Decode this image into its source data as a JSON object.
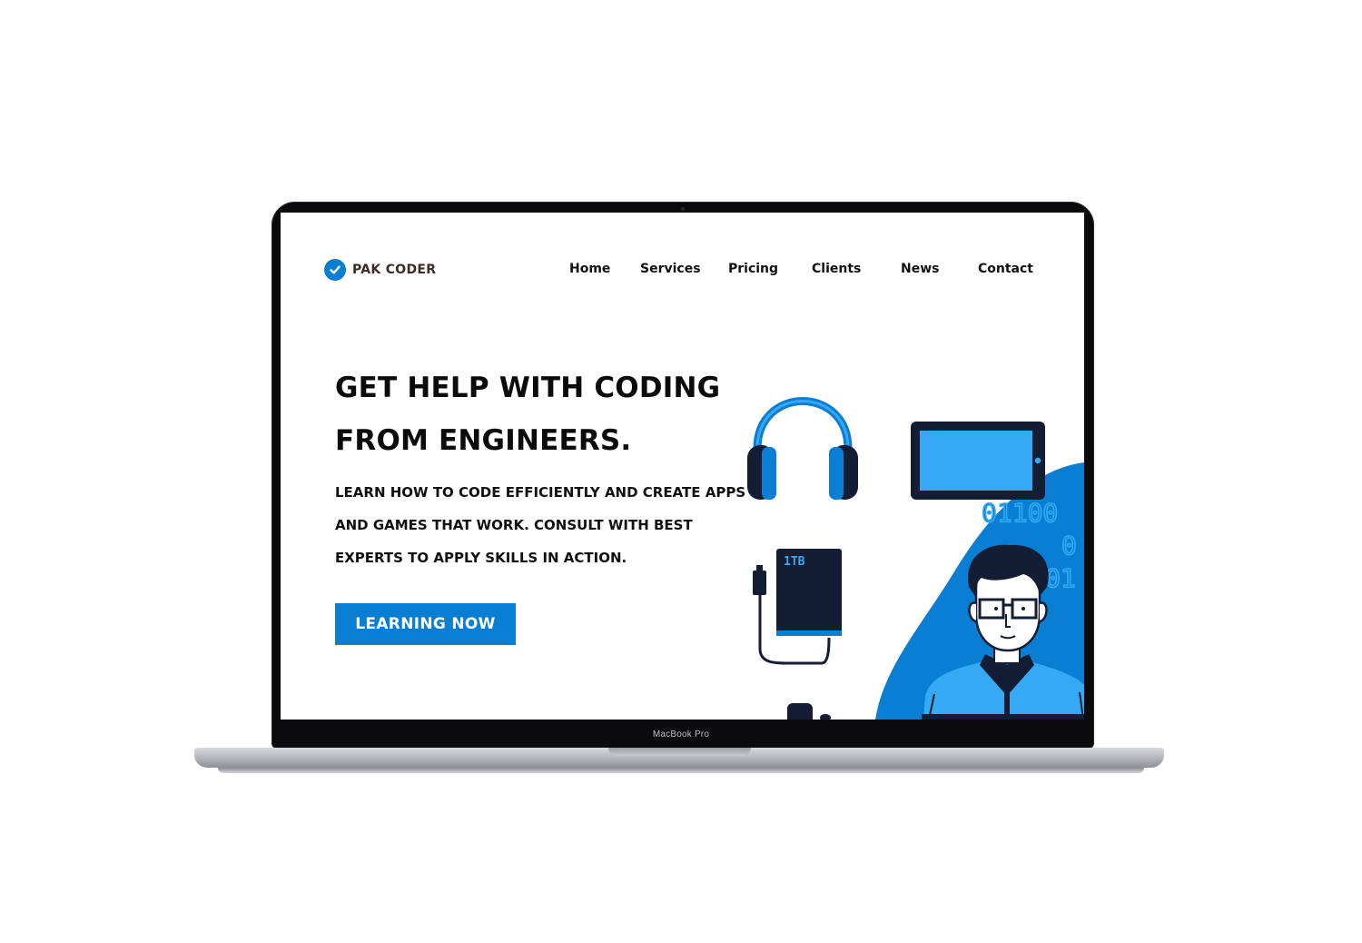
{
  "site": {
    "brand": "PAK CODER",
    "nav": [
      "Home",
      "Services",
      "Pricing",
      "Clients",
      "News",
      "Contact"
    ]
  },
  "hero": {
    "title": "GET HELP WITH CODING FROM ENGINEERS.",
    "description": "LEARN HOW TO CODE EFFICIENTLY AND CREATE APPS AND GAMES THAT WORK. CONSULT WITH BEST EXPERTS TO APPLY SKILLS IN ACTION.",
    "cta": "LEARNING NOW"
  },
  "illustration": {
    "drive_label": "1TB",
    "binary_rows": [
      "01100",
      "0",
      "01"
    ]
  },
  "device": {
    "label": "MacBook Pro"
  },
  "colors": {
    "accent": "#0a7ed2",
    "light_blue": "#36a9f4",
    "navy": "#131d33",
    "brand_text": "#3b2a26"
  }
}
